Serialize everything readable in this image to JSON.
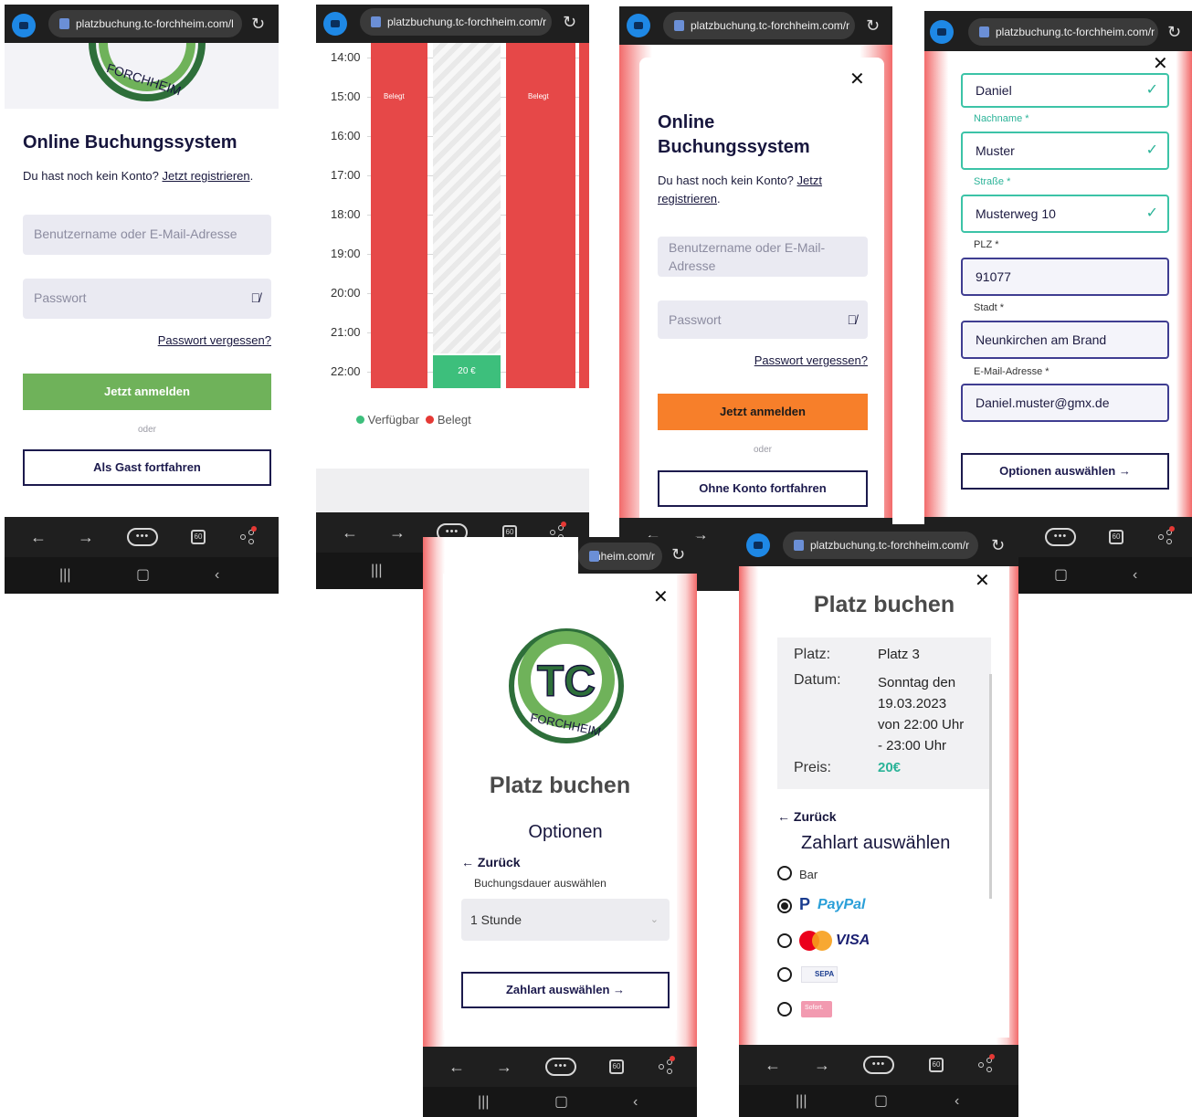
{
  "url": {
    "s1": "platzbuchung.tc-forchheim.com/l",
    "s2": "platzbuchung.tc-forchheim.com/r",
    "s3": "platzbuchung.tc-forchheim.com/r",
    "s4": "platzbuchung.tc-forchheim.com/r",
    "s5": "chheim.com/r",
    "s6": "platzbuchung.tc-forchheim.com/r"
  },
  "logo": {
    "initials": "TC",
    "ring_text": "FORCHHEIM"
  },
  "login": {
    "title_line1": "Online",
    "title_line2": "Buchungssystem",
    "title_full": "Online Buchungssystem",
    "no_account": "Du hast noch kein Konto?",
    "register": "Jetzt registrieren",
    "register_a": "Jetzt",
    "register_b": "registrieren",
    "period": ".",
    "user_placeholder": "Benutzername oder E-Mail-Adresse",
    "user_placeholder_a": "Benutzername oder E-Mail-",
    "user_placeholder_b": "Adresse",
    "password_placeholder": "Passwort",
    "forgot": "Passwort vergessen?",
    "login_button": "Jetzt anmelden",
    "or": "oder",
    "guest_button": "Als Gast fortfahren",
    "no_account_button": "Ohne Konto fortfahren"
  },
  "schedule": {
    "times": [
      "14:00",
      "15:00",
      "16:00",
      "17:00",
      "18:00",
      "19:00",
      "20:00",
      "21:00",
      "22:00"
    ],
    "occupied_label": "Belegt",
    "price_slot": "20 €",
    "legend": [
      {
        "label": "Verfügbar",
        "color": "#3dbf7c"
      },
      {
        "label": "Belegt",
        "color": "#e53935"
      }
    ]
  },
  "registration": {
    "firstname_value": "Daniel",
    "lastname_label": "Nachname *",
    "lastname_value": "Muster",
    "street_label": "Straße *",
    "street_value": "Musterweg 10",
    "zip_label": "PLZ *",
    "zip_value": "91077",
    "city_label": "Stadt *",
    "city_value": "Neunkirchen am Brand",
    "email_label": "E-Mail-Adresse *",
    "email_value": "Daniel.muster@gmx.de",
    "options_button": "Optionen auswählen"
  },
  "options": {
    "title": "Platz buchen",
    "subtitle": "Optionen",
    "back": "Zurück",
    "duration_label": "Buchungsdauer auswählen",
    "duration_value": "1 Stunde",
    "payment_button": "Zahlart auswählen"
  },
  "summary": {
    "title": "Platz buchen",
    "court_label": "Platz:",
    "court_value": "Platz 3",
    "date_label": "Datum:",
    "date_lines": [
      "Sonntag den",
      "19.03.2023",
      "von 22:00 Uhr",
      "- 23:00 Uhr"
    ],
    "price_label": "Preis:",
    "price_value": "20€",
    "back": "Zurück",
    "payment_title": "Zahlart auswählen",
    "payments": [
      {
        "label": "Bar",
        "selected": false
      },
      {
        "label": "PayPal",
        "selected": true
      },
      {
        "label": "VISA",
        "selected": false
      },
      {
        "label": "SEPA",
        "selected": false
      },
      {
        "label": "Sofort.",
        "selected": false
      }
    ]
  },
  "browser": {
    "tabs_count": "60",
    "menu": "•••"
  },
  "colors": {
    "navy": "#17163d",
    "green": "#6fb25a",
    "orange": "#f77f2a",
    "red": "#e53935",
    "teal": "#3cc3a7",
    "purple_border": "#3f3d91"
  },
  "icons": [
    "back-arrow-icon",
    "forward-arrow-icon",
    "menu-icon",
    "tabs-icon",
    "share-icon",
    "recents-icon",
    "home-icon",
    "nav-back-icon",
    "reload-icon",
    "lock-icon",
    "eye-off-icon",
    "close-icon",
    "check-icon",
    "arrow-right-icon",
    "arrow-left-icon",
    "chevron-down-icon"
  ]
}
